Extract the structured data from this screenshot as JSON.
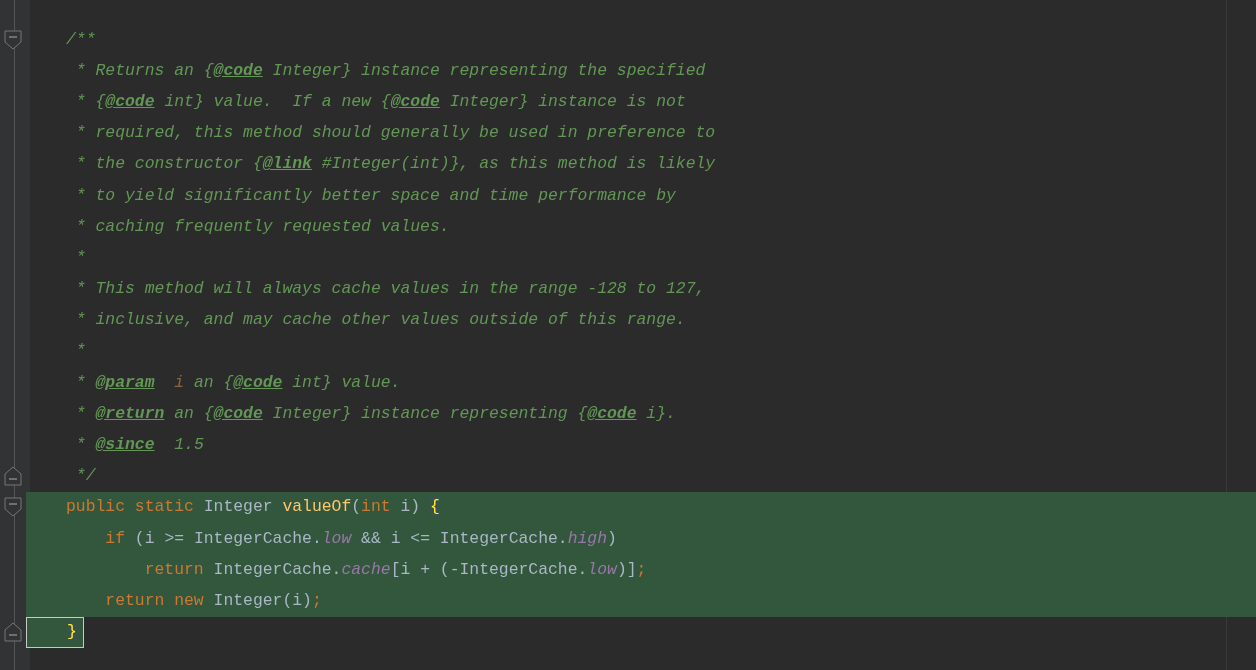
{
  "editor": {
    "lines": [
      {
        "fold_start": true,
        "fold_end": false,
        "highlighted": false,
        "tokens": [
          {
            "text": "/**",
            "kind": "comment"
          }
        ]
      },
      {
        "fold_start": false,
        "fold_end": false,
        "highlighted": false,
        "tokens": [
          {
            "text": " * Returns an {",
            "kind": "comment"
          },
          {
            "text": "@code",
            "kind": "tag"
          },
          {
            "text": " Integer} instance representing the specified",
            "kind": "comment"
          }
        ]
      },
      {
        "fold_start": false,
        "fold_end": false,
        "highlighted": false,
        "tokens": [
          {
            "text": " * {",
            "kind": "comment"
          },
          {
            "text": "@code",
            "kind": "tag"
          },
          {
            "text": " int} value.  If a new {",
            "kind": "comment"
          },
          {
            "text": "@code",
            "kind": "tag"
          },
          {
            "text": " Integer} instance is not",
            "kind": "comment"
          }
        ]
      },
      {
        "fold_start": false,
        "fold_end": false,
        "highlighted": false,
        "tokens": [
          {
            "text": " * required, this method should generally be used in preference to",
            "kind": "comment"
          }
        ]
      },
      {
        "fold_start": false,
        "fold_end": false,
        "highlighted": false,
        "tokens": [
          {
            "text": " * the constructor {",
            "kind": "comment"
          },
          {
            "text": "@link",
            "kind": "tag"
          },
          {
            "text": " #Integer(int)}, as this method is likely",
            "kind": "comment"
          }
        ]
      },
      {
        "fold_start": false,
        "fold_end": false,
        "highlighted": false,
        "tokens": [
          {
            "text": " * to yield significantly better space and time performance by",
            "kind": "comment"
          }
        ]
      },
      {
        "fold_start": false,
        "fold_end": false,
        "highlighted": false,
        "tokens": [
          {
            "text": " * caching frequently requested values.",
            "kind": "comment"
          }
        ]
      },
      {
        "fold_start": false,
        "fold_end": false,
        "highlighted": false,
        "tokens": [
          {
            "text": " *",
            "kind": "comment"
          }
        ]
      },
      {
        "fold_start": false,
        "fold_end": false,
        "highlighted": false,
        "tokens": [
          {
            "text": " * This method will always cache values in the range -128 to 127,",
            "kind": "comment"
          }
        ]
      },
      {
        "fold_start": false,
        "fold_end": false,
        "highlighted": false,
        "tokens": [
          {
            "text": " * inclusive, and may cache other values outside of this range.",
            "kind": "comment"
          }
        ]
      },
      {
        "fold_start": false,
        "fold_end": false,
        "highlighted": false,
        "tokens": [
          {
            "text": " *",
            "kind": "comment"
          }
        ]
      },
      {
        "fold_start": false,
        "fold_end": false,
        "highlighted": false,
        "tokens": [
          {
            "text": " * ",
            "kind": "comment"
          },
          {
            "text": "@param",
            "kind": "tag"
          },
          {
            "text": "  i",
            "kind": "param"
          },
          {
            "text": " an {",
            "kind": "comment"
          },
          {
            "text": "@code",
            "kind": "tag"
          },
          {
            "text": " int} value.",
            "kind": "comment"
          }
        ]
      },
      {
        "fold_start": false,
        "fold_end": false,
        "highlighted": false,
        "tokens": [
          {
            "text": " * ",
            "kind": "comment"
          },
          {
            "text": "@return",
            "kind": "tag"
          },
          {
            "text": " an {",
            "kind": "comment"
          },
          {
            "text": "@code",
            "kind": "tag"
          },
          {
            "text": " Integer} instance representing {",
            "kind": "comment"
          },
          {
            "text": "@code",
            "kind": "tag"
          },
          {
            "text": " i}.",
            "kind": "comment"
          }
        ]
      },
      {
        "fold_start": false,
        "fold_end": false,
        "highlighted": false,
        "tokens": [
          {
            "text": " * ",
            "kind": "comment"
          },
          {
            "text": "@since",
            "kind": "tag"
          },
          {
            "text": "  1.5",
            "kind": "comment"
          }
        ]
      },
      {
        "fold_start": false,
        "fold_end": true,
        "highlighted": false,
        "tokens": [
          {
            "text": " */",
            "kind": "comment"
          }
        ]
      },
      {
        "fold_start": true,
        "fold_end": false,
        "highlighted": true,
        "tokens": [
          {
            "text": "public static",
            "kind": "keyword"
          },
          {
            "text": " Integer ",
            "kind": "plain"
          },
          {
            "text": "valueOf",
            "kind": "method"
          },
          {
            "text": "(",
            "kind": "plain"
          },
          {
            "text": "int",
            "kind": "keyword"
          },
          {
            "text": " i) ",
            "kind": "plain"
          },
          {
            "text": "{",
            "kind": "brace_match"
          }
        ]
      },
      {
        "fold_start": false,
        "fold_end": false,
        "highlighted": true,
        "tokens": [
          {
            "text": "    if",
            "kind": "keyword"
          },
          {
            "text": " (i >= IntegerCache.",
            "kind": "plain"
          },
          {
            "text": "low",
            "kind": "field"
          },
          {
            "text": " && i <= IntegerCache.",
            "kind": "plain"
          },
          {
            "text": "high",
            "kind": "field"
          },
          {
            "text": ")",
            "kind": "plain"
          }
        ]
      },
      {
        "fold_start": false,
        "fold_end": false,
        "highlighted": true,
        "tokens": [
          {
            "text": "        return",
            "kind": "keyword"
          },
          {
            "text": " IntegerCache.",
            "kind": "plain"
          },
          {
            "text": "cache",
            "kind": "field"
          },
          {
            "text": "[i + (-IntegerCache.",
            "kind": "plain"
          },
          {
            "text": "low",
            "kind": "field"
          },
          {
            "text": ")]",
            "kind": "plain"
          },
          {
            "text": ";",
            "kind": "keyword"
          }
        ]
      },
      {
        "fold_start": false,
        "fold_end": false,
        "highlighted": true,
        "tokens": [
          {
            "text": "    return new",
            "kind": "keyword"
          },
          {
            "text": " Integer(i)",
            "kind": "plain"
          },
          {
            "text": ";",
            "kind": "keyword"
          }
        ]
      },
      {
        "fold_start": false,
        "fold_end": true,
        "highlighted": true,
        "tokens": [
          {
            "text": "}",
            "kind": "brace_match"
          }
        ]
      }
    ]
  }
}
